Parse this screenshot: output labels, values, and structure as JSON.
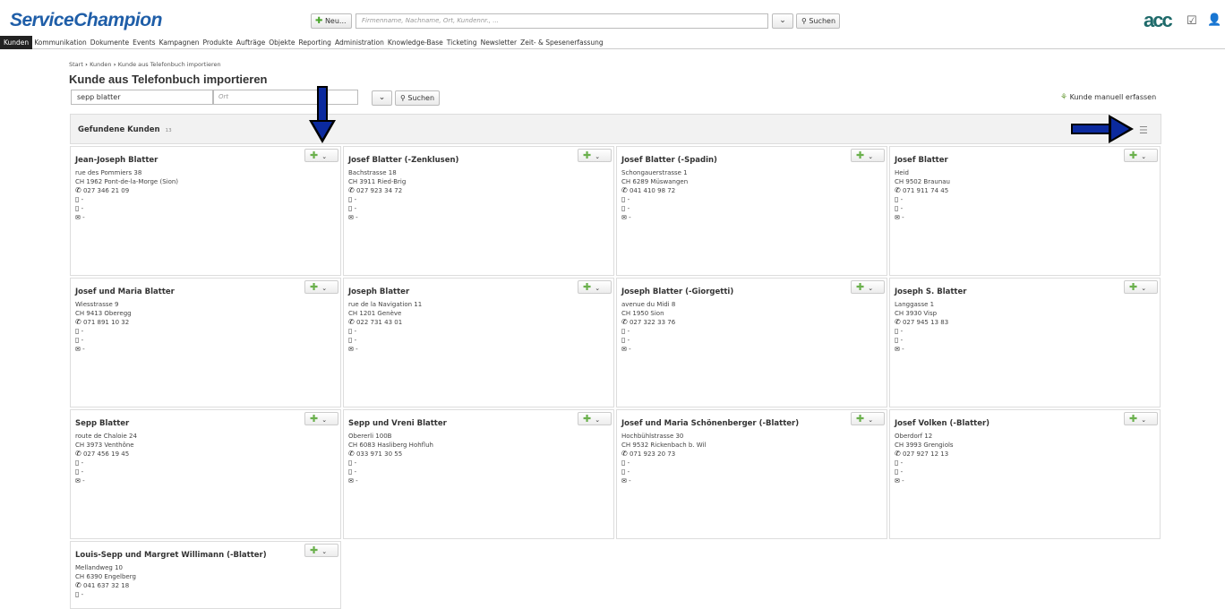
{
  "app": {
    "logo_text": "ServiceChampion",
    "new_button_label": "Neu...",
    "search_placeholder": "Firmenname, Nachname, Ort, Kundennr., ...",
    "search_button_label": "Suchen",
    "brand_mark": "acc"
  },
  "nav": {
    "items": [
      {
        "label": "Kunden",
        "active": true
      },
      {
        "label": "Kommunikation"
      },
      {
        "label": "Dokumente"
      },
      {
        "label": "Events"
      },
      {
        "label": "Kampagnen"
      },
      {
        "label": "Produkte"
      },
      {
        "label": "Aufträge"
      },
      {
        "label": "Objekte"
      },
      {
        "label": "Reporting"
      },
      {
        "label": "Administration"
      },
      {
        "label": "Knowledge-Base"
      },
      {
        "label": "Ticketing"
      },
      {
        "label": "Newsletter"
      },
      {
        "label": "Zeit- & Spesenerfassung"
      }
    ]
  },
  "breadcrumb": {
    "items": [
      "Start",
      "Kunden",
      "Kunde aus Telefonbuch importieren"
    ]
  },
  "page": {
    "title": "Kunde aus Telefonbuch importieren",
    "name_value": "sepp blatter",
    "place_placeholder": "Ort",
    "search_button_label": "Suchen",
    "manual_link": "Kunde manuell erfassen"
  },
  "results": {
    "title": "Gefundene Kunden",
    "count": "13",
    "cards": [
      {
        "name": "Jean-Joseph Blatter",
        "street": "rue des Pommiers 38",
        "city": "CH 1962 Pont-de-la-Morge (Sion)",
        "phone": "027 346 21 09",
        "mobile": "-",
        "fax": "-",
        "email": "-"
      },
      {
        "name": "Josef Blatter (-Zenklusen)",
        "street": "Bachstrasse 18",
        "city": "CH 3911 Ried-Brig",
        "phone": "027 923 34 72",
        "mobile": "-",
        "fax": "-",
        "email": "-"
      },
      {
        "name": "Josef Blatter (-Spadin)",
        "street": "Schongauerstrasse 1",
        "city": "CH 6289 Müswangen",
        "phone": "041 410 98 72",
        "mobile": "-",
        "fax": "-",
        "email": "-"
      },
      {
        "name": "Josef Blatter",
        "street": "Heid",
        "city": "CH 9502 Braunau",
        "phone": "071 911 74 45",
        "mobile": "-",
        "fax": "-",
        "email": "-"
      },
      {
        "name": "Josef und Maria Blatter",
        "street": "Wiesstrasse 9",
        "city": "CH 9413 Oberegg",
        "phone": "071 891 10 32",
        "mobile": "-",
        "fax": "-",
        "email": "-"
      },
      {
        "name": "Joseph Blatter",
        "street": "rue de la Navigation 11",
        "city": "CH 1201 Genève",
        "phone": "022 731 43 01",
        "mobile": "-",
        "fax": "-",
        "email": "-"
      },
      {
        "name": "Joseph Blatter (-Giorgetti)",
        "street": "avenue du Midi 8",
        "city": "CH 1950 Sion",
        "phone": "027 322 33 76",
        "mobile": "-",
        "fax": "-",
        "email": "-"
      },
      {
        "name": "Joseph S. Blatter",
        "street": "Langgasse 1",
        "city": "CH 3930 Visp",
        "phone": "027 945 13 83",
        "mobile": "-",
        "fax": "-",
        "email": "-"
      },
      {
        "name": "Sepp Blatter",
        "street": "route de Chaloie 24",
        "city": "CH 3973 Venthône",
        "phone": "027 456 19 45",
        "mobile": "-",
        "fax": "-",
        "email": "-"
      },
      {
        "name": "Sepp und Vreni Blatter",
        "street": "Obererli 100B",
        "city": "CH 6083 Hasliberg Hohfluh",
        "phone": "033 971 30 55",
        "mobile": "-",
        "fax": "-",
        "email": "-"
      },
      {
        "name": "Josef und Maria Schönenberger (-Blatter)",
        "street": "Hochbühlstrasse 30",
        "city": "CH 9532 Rickenbach b. Wil",
        "phone": "071 923 20 73",
        "mobile": "-",
        "fax": "-",
        "email": "-"
      },
      {
        "name": "Josef Volken (-Blatter)",
        "street": "Oberdorf 12",
        "city": "CH 3993 Grengiols",
        "phone": "027 927 12 13",
        "mobile": "-",
        "fax": "-",
        "email": "-"
      },
      {
        "name": "Louis-Sepp und Margret Willimann (-Blatter)",
        "street": "Mellandweg 10",
        "city": "CH 6390 Engelberg",
        "phone": "041 637 32 18",
        "mobile": "-",
        "fax": "",
        "email": ""
      }
    ]
  },
  "colors": {
    "brand_blue": "#1f5ea8",
    "add_green": "#6ab04c",
    "arrow_blue": "#0b2a9e"
  }
}
